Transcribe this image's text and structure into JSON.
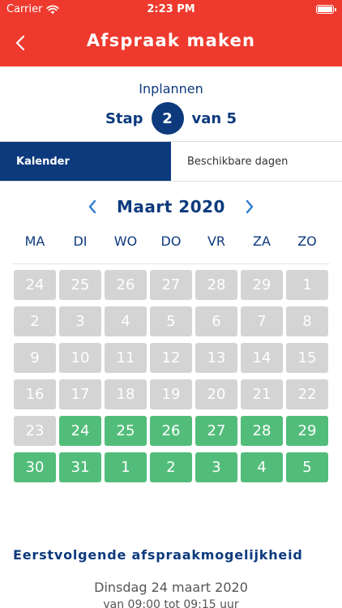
{
  "status_bar": {
    "carrier": "Carrier",
    "time": "2:23 PM"
  },
  "header": {
    "title": "Afspraak maken",
    "back_icon": "chevron-left-icon"
  },
  "step": {
    "subtitle": "Inplannen",
    "prefix": "Stap",
    "current": "2",
    "suffix": "van 5"
  },
  "tabs": [
    {
      "label": "Kalender",
      "active": true
    },
    {
      "label": "Beschikbare dagen",
      "active": false
    }
  ],
  "calendar": {
    "month": "Maart 2020",
    "weekdays": [
      "MA",
      "DI",
      "WO",
      "DO",
      "VR",
      "ZA",
      "ZO"
    ],
    "weeks": [
      [
        {
          "d": "24",
          "available": false
        },
        {
          "d": "25",
          "available": false
        },
        {
          "d": "26",
          "available": false
        },
        {
          "d": "27",
          "available": false
        },
        {
          "d": "28",
          "available": false
        },
        {
          "d": "29",
          "available": false
        },
        {
          "d": "1",
          "available": false
        }
      ],
      [
        {
          "d": "2",
          "available": false
        },
        {
          "d": "3",
          "available": false
        },
        {
          "d": "4",
          "available": false
        },
        {
          "d": "5",
          "available": false
        },
        {
          "d": "6",
          "available": false
        },
        {
          "d": "7",
          "available": false
        },
        {
          "d": "8",
          "available": false
        }
      ],
      [
        {
          "d": "9",
          "available": false
        },
        {
          "d": "10",
          "available": false
        },
        {
          "d": "11",
          "available": false
        },
        {
          "d": "12",
          "available": false
        },
        {
          "d": "13",
          "available": false
        },
        {
          "d": "14",
          "available": false
        },
        {
          "d": "15",
          "available": false
        }
      ],
      [
        {
          "d": "16",
          "available": false
        },
        {
          "d": "17",
          "available": false
        },
        {
          "d": "18",
          "available": false
        },
        {
          "d": "19",
          "available": false
        },
        {
          "d": "20",
          "available": false
        },
        {
          "d": "21",
          "available": false
        },
        {
          "d": "22",
          "available": false
        }
      ],
      [
        {
          "d": "23",
          "available": false
        },
        {
          "d": "24",
          "available": true
        },
        {
          "d": "25",
          "available": true
        },
        {
          "d": "26",
          "available": true
        },
        {
          "d": "27",
          "available": true
        },
        {
          "d": "28",
          "available": true
        },
        {
          "d": "29",
          "available": true
        }
      ],
      [
        {
          "d": "30",
          "available": true
        },
        {
          "d": "31",
          "available": true
        },
        {
          "d": "1",
          "available": true
        },
        {
          "d": "2",
          "available": true
        },
        {
          "d": "3",
          "available": true
        },
        {
          "d": "4",
          "available": true
        },
        {
          "d": "5",
          "available": true
        }
      ]
    ]
  },
  "next": {
    "heading": "Eerstvolgende afspraakmogelijkheid",
    "date": "Dinsdag 24 maart 2020",
    "time": "van 09:00 tot 09:15 uur"
  },
  "colors": {
    "header_red": "#ee3a2e",
    "primary_blue": "#0d3a7d",
    "available_green": "#52bd7a",
    "unavailable_grey": "#d4d4d4"
  }
}
